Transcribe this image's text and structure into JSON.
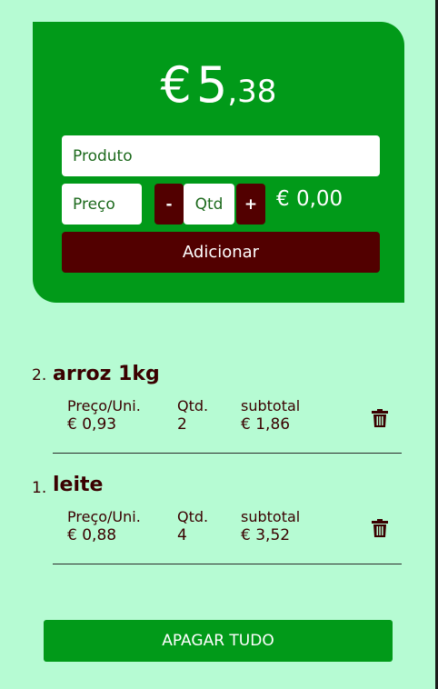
{
  "summary": {
    "currency_symbol": "€",
    "total_integer": "5",
    "total_cents": ",38"
  },
  "form": {
    "product_placeholder": "Produto",
    "price_placeholder": "Preço",
    "qty_placeholder": "Qtd",
    "minus_label": "-",
    "plus_label": "+",
    "line_total": "€ 0,00",
    "add_label": "Adicionar"
  },
  "items": [
    {
      "index": "2.",
      "name": "arroz 1kg",
      "unit_price_label": "Preço/Uni.",
      "unit_price": "€ 0,93",
      "qty_label": "Qtd.",
      "qty": "2",
      "subtotal_label": "subtotal",
      "subtotal": "€ 1,86",
      "delete_icon": "trash-icon"
    },
    {
      "index": "1.",
      "name": "leite",
      "unit_price_label": "Preço/Uni.",
      "unit_price": "€ 0,88",
      "qty_label": "Qtd.",
      "qty": "4",
      "subtotal_label": "subtotal",
      "subtotal": "€ 3,52",
      "delete_icon": "trash-icon"
    }
  ],
  "footer": {
    "clear_all_label": "APAGAR TUDO"
  },
  "colors": {
    "background": "#b6fbd3",
    "card_green": "#019a19",
    "dark_red": "#520000",
    "text_dark": "#3a0000"
  }
}
